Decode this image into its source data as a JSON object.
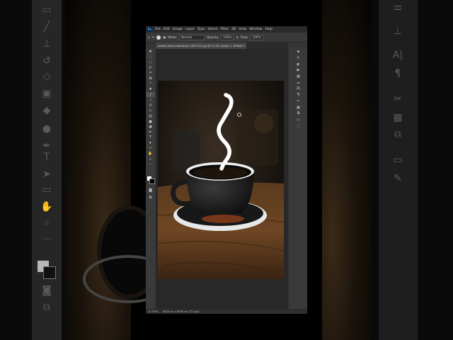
{
  "menu": [
    "File",
    "Edit",
    "Image",
    "Layer",
    "Type",
    "Select",
    "Filter",
    "3D",
    "View",
    "Window",
    "Help"
  ],
  "app_logo": "Ps",
  "options": {
    "mode_label": "Mode:",
    "mode_value": "Normal",
    "opacity_label": "Opacity:",
    "opacity_value": "100%",
    "flow_label": "Flow:",
    "flow_value": "100%"
  },
  "document_tab": "pexels-eneo-cobmosyk-1267122.jpg @ 12.4% (Layer 1, RGB/8) *",
  "status": {
    "zoom": "12.39%",
    "dimensions": "4000 px x 6000 px (72 ppi)"
  },
  "icons": {
    "left_tools": [
      "move-icon",
      "marquee-icon",
      "lasso-icon",
      "quick-select-icon",
      "crop-icon",
      "frame-icon",
      "eyedropper-icon",
      "healing-icon",
      "brush-icon",
      "clone-stamp-icon",
      "history-brush-icon",
      "eraser-icon",
      "gradient-icon",
      "blur-icon",
      "dodge-icon",
      "pen-icon",
      "type-icon",
      "path-select-icon",
      "rectangle-icon",
      "hand-icon",
      "zoom-icon",
      "more-icon"
    ],
    "right_panel": [
      "layers-icon",
      "brush-settings-icon",
      "adjustments-icon",
      "actions-icon",
      "swatches-icon",
      "libraries-icon",
      "character-icon",
      "paragraph-icon",
      "tools-icon",
      "grid-icon",
      "export-icon",
      "folder-icon",
      "gradient-swatch-icon"
    ]
  },
  "colors": {
    "ps_accent": "#31a8ff",
    "foreground": "#ffffff",
    "background": "#000000"
  }
}
